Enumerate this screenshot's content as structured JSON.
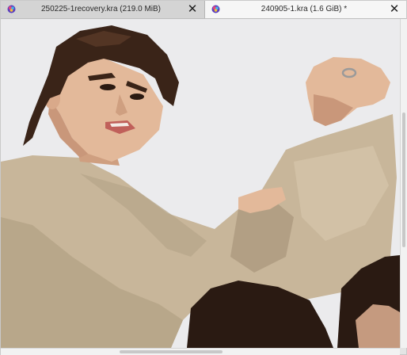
{
  "tabs": [
    {
      "title": "250225-1recovery.kra (219.0 MiB)",
      "close_label": "✕",
      "icon": "krita-app-icon",
      "active": false
    },
    {
      "title": "240905-1.kra (1.6 GiB) *",
      "close_label": "✕",
      "icon": "krita-app-icon",
      "active": true
    }
  ],
  "canvas": {
    "artwork": "digital-painting",
    "background_color": "#ebebed"
  },
  "colors": {
    "hair": "#3a2418",
    "skin": "#e3b99a",
    "shirt": "#c8b69a",
    "shirt_shadow": "#a8967a"
  }
}
